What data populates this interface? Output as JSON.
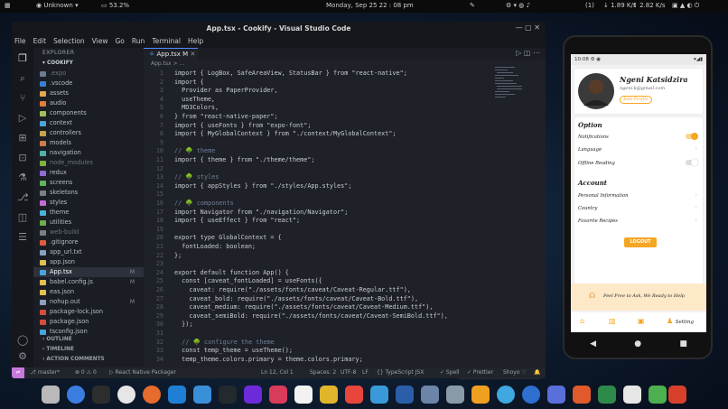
{
  "topbar": {
    "workspace": "Unknown",
    "battery": "53.2%",
    "clock": "Monday, Sep 25  22 : 08  pm",
    "notif_count": "(1)",
    "net_down": "1.89 K/s",
    "net_up": "2.82 K/s"
  },
  "vscode": {
    "title": "App.tsx - Cookify - Visual Studio Code",
    "menu": [
      "File",
      "Edit",
      "Selection",
      "View",
      "Go",
      "Run",
      "Terminal",
      "Help"
    ],
    "explorer_label": "EXPLORER",
    "project": "COOKIFY",
    "files": [
      {
        "name": ".expo",
        "color": "#6d7b93",
        "dim": true
      },
      {
        "name": ".vscode",
        "color": "#3b80d1"
      },
      {
        "name": "assets",
        "color": "#e0a84f"
      },
      {
        "name": "audio",
        "color": "#e07c3c"
      },
      {
        "name": "components",
        "color": "#a0c05a"
      },
      {
        "name": "context",
        "color": "#4da3d9"
      },
      {
        "name": "controllers",
        "color": "#c7a34a"
      },
      {
        "name": "models",
        "color": "#d07b4a"
      },
      {
        "name": "navigation",
        "color": "#4db3a8"
      },
      {
        "name": "node_modules",
        "color": "#7cb342",
        "dim": true
      },
      {
        "name": "redux",
        "color": "#8e6cd6"
      },
      {
        "name": "screens",
        "color": "#5fb55a"
      },
      {
        "name": "skeletons",
        "color": "#7a7f88"
      },
      {
        "name": "styles",
        "color": "#c66ad6"
      },
      {
        "name": "theme",
        "color": "#4bb3d6"
      },
      {
        "name": "utilities",
        "color": "#6ab04c"
      },
      {
        "name": "web-build",
        "color": "#7a7f88",
        "dim": true
      },
      {
        "name": ".gitignore",
        "color": "#e05c3c"
      },
      {
        "name": "app_url.txt",
        "color": "#8aa0c0"
      },
      {
        "name": "app.json",
        "color": "#e2c04f"
      },
      {
        "name": "App.tsx",
        "color": "#4aa3df",
        "badge": "M",
        "sel": true
      },
      {
        "name": "babel.config.js",
        "color": "#e2c04f",
        "badge": "M"
      },
      {
        "name": "eas.json",
        "color": "#e2c04f"
      },
      {
        "name": "nohup.out",
        "color": "#8aa0c0",
        "badge": "M"
      },
      {
        "name": "package-lock.json",
        "color": "#d04f3c"
      },
      {
        "name": "package.json",
        "color": "#d04f3c"
      },
      {
        "name": "tsconfig.json",
        "color": "#4aa3df"
      }
    ],
    "sections": [
      "OUTLINE",
      "TIMELINE",
      "ACTION COMMENTS"
    ],
    "tab": "App.tsx M",
    "breadcrumb": "App.tsx > ...",
    "lines": [
      {
        "n": "1",
        "t": "import { LogBox, SafeAreaView, StatusBar } from \"react-native\";",
        "c": "#c8ccd4"
      },
      {
        "n": "2",
        "t": "import {",
        "c": "#c8ccd4"
      },
      {
        "n": "3",
        "t": "  Provider as PaperProvider,",
        "c": "#c8ccd4"
      },
      {
        "n": "4",
        "t": "  useTheme,",
        "c": "#c8ccd4"
      },
      {
        "n": "5",
        "t": "  MD3Colors,",
        "c": "#c8ccd4"
      },
      {
        "n": "6",
        "t": "} from \"react-native-paper\";",
        "c": "#c8ccd4"
      },
      {
        "n": "7",
        "t": "import { useFonts } from \"expo-font\";",
        "c": "#c8ccd4"
      },
      {
        "n": "8",
        "t": "import { MyGlobalContext } from \"./context/MyGlobalContext\";",
        "c": "#c8ccd4"
      },
      {
        "n": "9",
        "t": "",
        "c": "#c8ccd4"
      },
      {
        "n": "10",
        "t": "// 🌳 theme",
        "c": "#6f7f98"
      },
      {
        "n": "11",
        "t": "import { theme } from \"./theme/theme\";",
        "c": "#c8ccd4"
      },
      {
        "n": "12",
        "t": "",
        "c": "#c8ccd4"
      },
      {
        "n": "13",
        "t": "// 🌳 styles",
        "c": "#6f7f98"
      },
      {
        "n": "14",
        "t": "import { appStyles } from \"./styles/App.styles\";",
        "c": "#c8ccd4"
      },
      {
        "n": "15",
        "t": "",
        "c": "#c8ccd4"
      },
      {
        "n": "16",
        "t": "// 🌳 components",
        "c": "#6f7f98"
      },
      {
        "n": "17",
        "t": "import Navigator from \"./navigation/Navigator\";",
        "c": "#c8ccd4"
      },
      {
        "n": "18",
        "t": "import { useEffect } from \"react\";",
        "c": "#c8ccd4"
      },
      {
        "n": "19",
        "t": "",
        "c": "#c8ccd4"
      },
      {
        "n": "20",
        "t": "export type GlobalContext = {",
        "c": "#c8ccd4"
      },
      {
        "n": "21",
        "t": "  fontLoaded: boolean;",
        "c": "#c8ccd4"
      },
      {
        "n": "22",
        "t": "};",
        "c": "#c8ccd4"
      },
      {
        "n": "23",
        "t": "",
        "c": "#c8ccd4"
      },
      {
        "n": "24",
        "t": "export default function App() {",
        "c": "#c8ccd4"
      },
      {
        "n": "25",
        "t": "  const [caveat_fontLoaded] = useFonts({",
        "c": "#c8ccd4"
      },
      {
        "n": "26",
        "t": "    caveat: require(\"./assets/fonts/caveat/Caveat-Regular.ttf\"),",
        "c": "#c8ccd4"
      },
      {
        "n": "27",
        "t": "    caveat_bold: require(\"./assets/fonts/caveat/Caveat-Bold.ttf\"),",
        "c": "#c8ccd4"
      },
      {
        "n": "28",
        "t": "    caveat_medium: require(\"./assets/fonts/caveat/Caveat-Medium.ttf\"),",
        "c": "#c8ccd4"
      },
      {
        "n": "29",
        "t": "    caveat_semiBold: require(\"./assets/fonts/caveat/Caveat-SemiBold.ttf\"),",
        "c": "#c8ccd4"
      },
      {
        "n": "30",
        "t": "  });",
        "c": "#c8ccd4"
      },
      {
        "n": "31",
        "t": "",
        "c": "#c8ccd4"
      },
      {
        "n": "32",
        "t": "  // 🌳 configure the theme",
        "c": "#6f7f98"
      },
      {
        "n": "33",
        "t": "  const temp_theme = useTheme();",
        "c": "#c8ccd4"
      },
      {
        "n": "34",
        "t": "  temp_theme.colors.primary = theme.colors.primary;",
        "c": "#c8ccd4"
      }
    ],
    "status": {
      "branch": "master*",
      "problems": "⊗ 0 ⚠ 0",
      "packager": "React Native Packager",
      "cursor": "Ln 12, Col 1",
      "spaces": "Spaces: 2",
      "enc": "UTF-8",
      "eol": "LF",
      "lang": "{} TypeScript JSX",
      "spell": "✓ Spell",
      "prettier": "✓ Prettier",
      "user": "Shoyo ♡"
    }
  },
  "phone": {
    "time": "10:08",
    "name": "Ngeni Katsidzira",
    "email": "ngeni.k@gmail.com",
    "edit_label": "Edit Profile",
    "option_title": "Option",
    "options": [
      "Notifications",
      "Language",
      "Offline Reading"
    ],
    "account_title": "Account",
    "account_items": [
      "Personal Information",
      "Country",
      "Favorite Recipes"
    ],
    "logout": "LOGOUT",
    "banner": "Feel Free to Ask, We Ready to Help",
    "nav_setting": "Setting",
    "accent": "#f5a623"
  }
}
